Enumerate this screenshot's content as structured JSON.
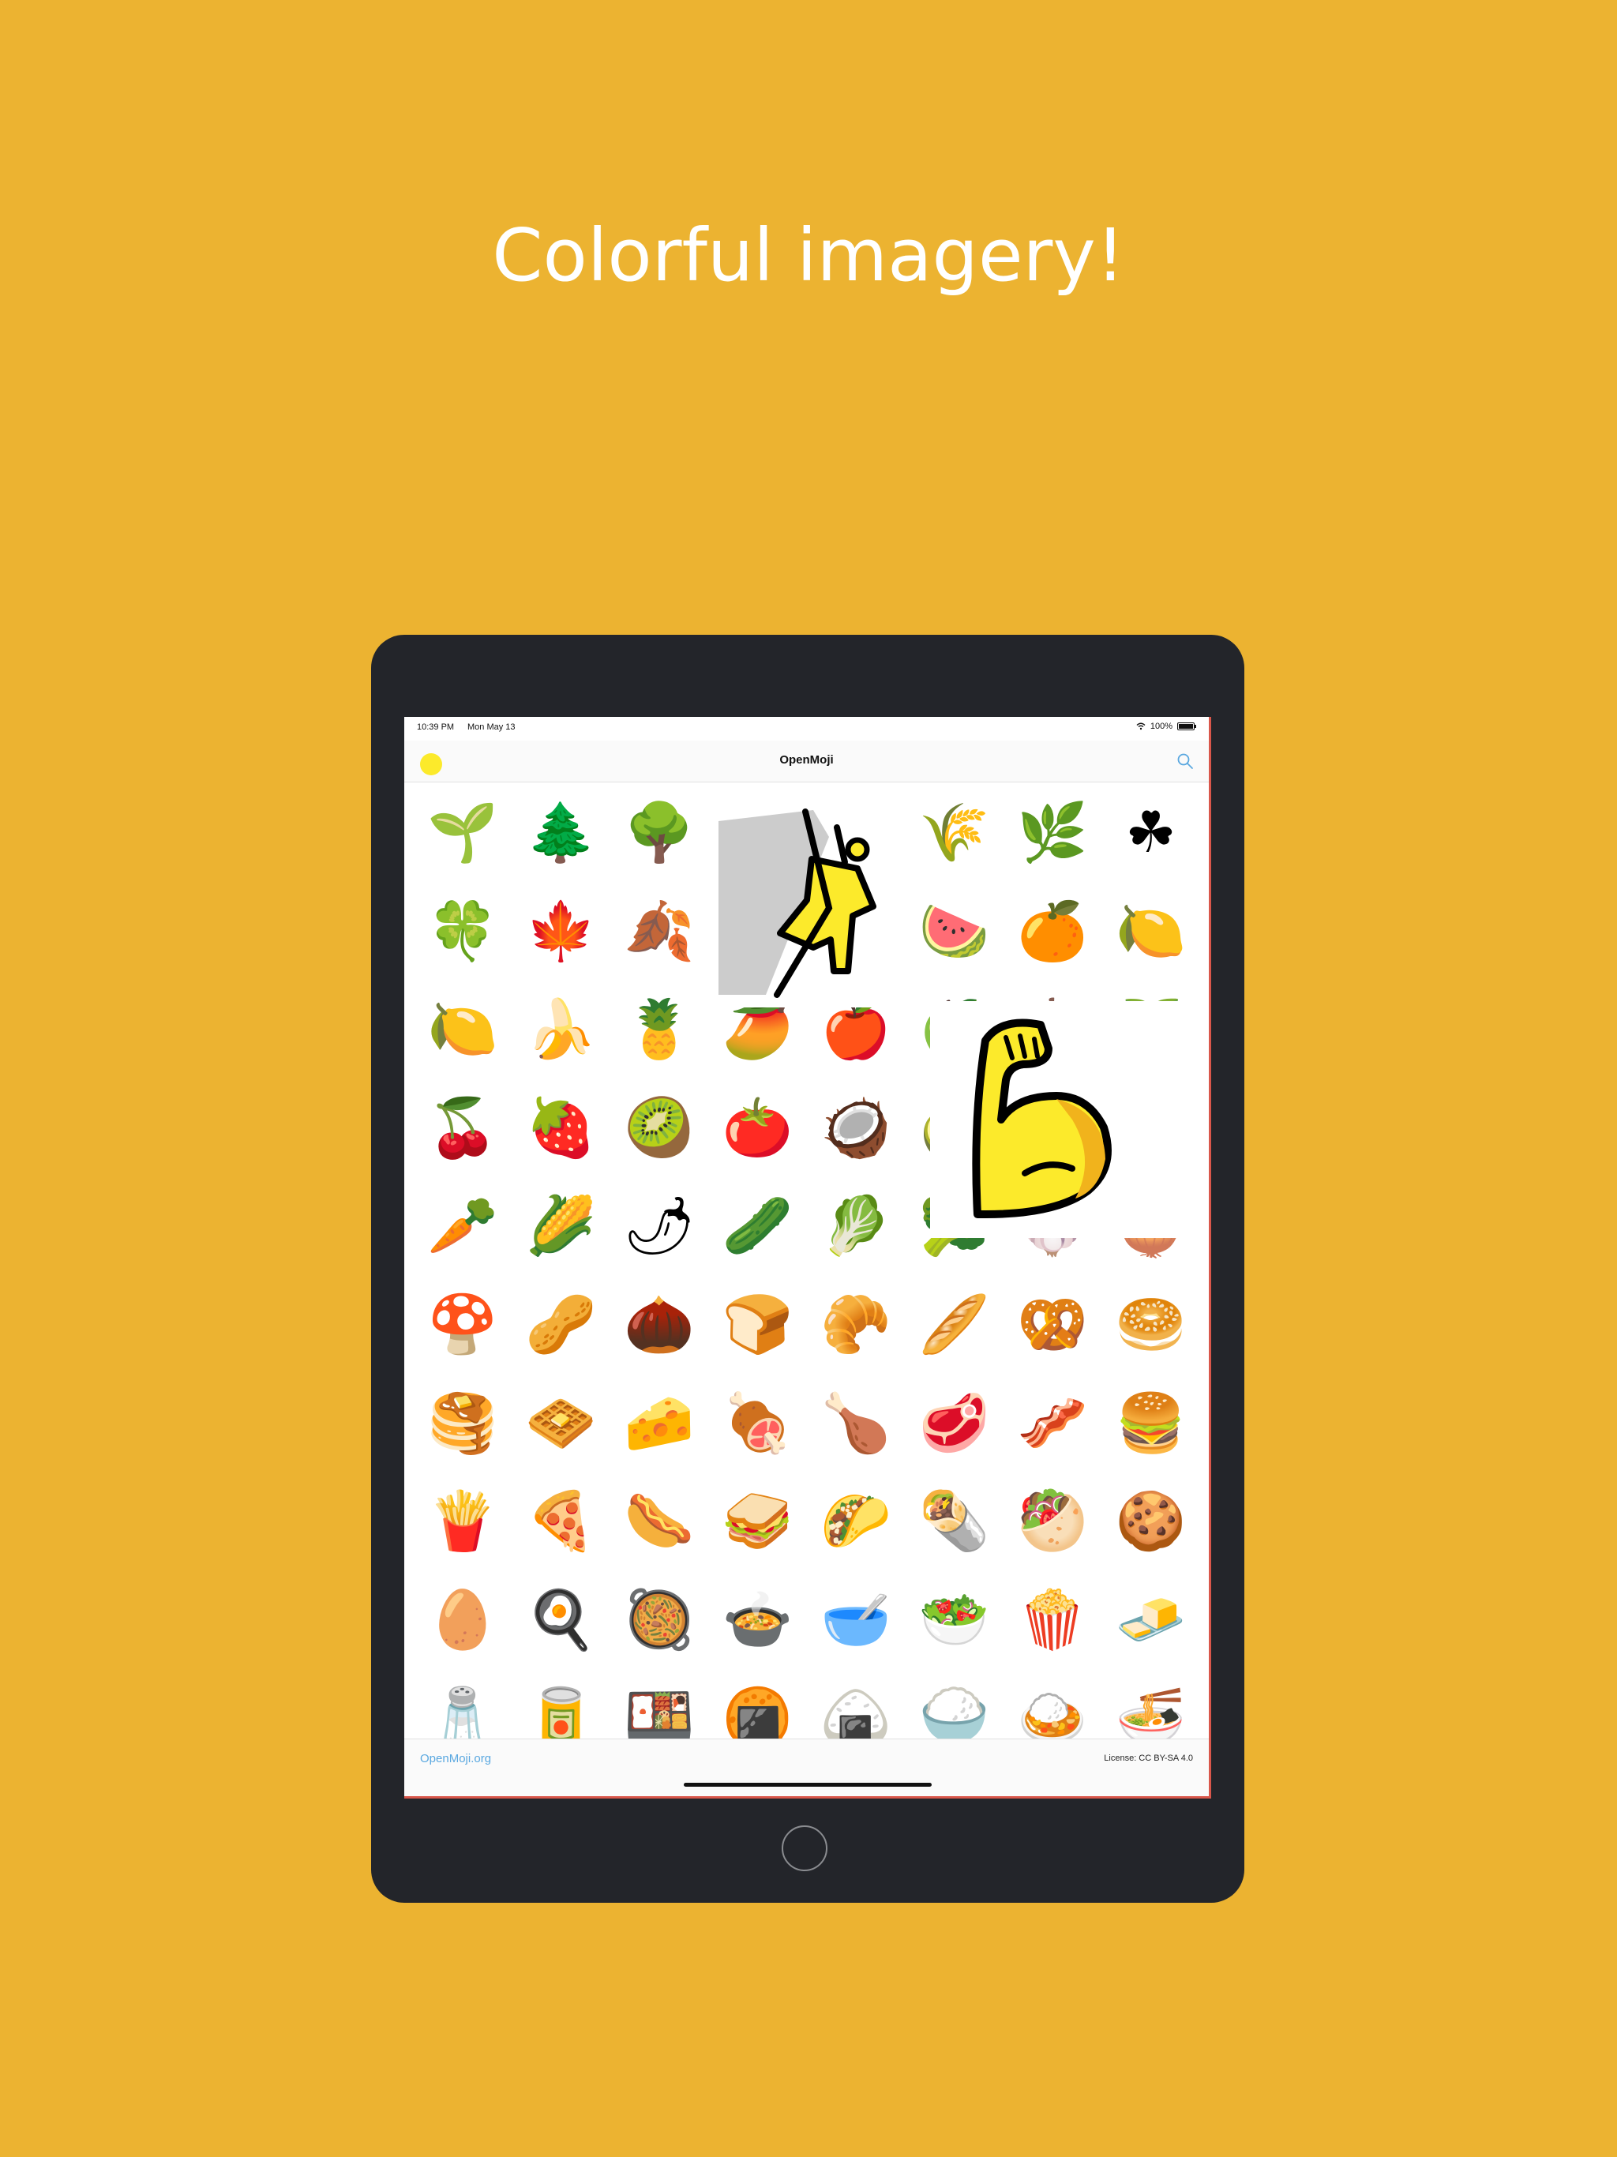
{
  "headline": "Colorful imagery!",
  "status_bar": {
    "time": "10:39 PM",
    "date": "Mon May 13",
    "battery": "100%"
  },
  "nav": {
    "title": "OpenMoji",
    "avatar_color": "#FCEA2B"
  },
  "emoji_grid": [
    [
      "🌱",
      "🌲",
      "🌳",
      "🌴",
      "🌵",
      "🌾",
      "🌿",
      "☘"
    ],
    [
      "🍀",
      "🍁",
      "🍂",
      "🍃",
      "🍈",
      "🍉",
      "🍊",
      "🍋"
    ],
    [
      "🍋",
      "🍌",
      "🍍",
      "🥭",
      "🍎",
      "🍏",
      "🍐",
      "🍑"
    ],
    [
      "🍒",
      "🍓",
      "🥝",
      "🍅",
      "🥥",
      "🥑",
      "🍆",
      "🥔"
    ],
    [
      "🥕",
      "🌽",
      "🌶",
      "🥒",
      "🥬",
      "🥦",
      "🧄",
      "🧅"
    ],
    [
      "🍄",
      "🥜",
      "🌰",
      "🍞",
      "🥐",
      "🥖",
      "🥨",
      "🥯"
    ],
    [
      "🥞",
      "🧇",
      "🧀",
      "🍖",
      "🍗",
      "🥩",
      "🥓",
      "🍔"
    ],
    [
      "🍟",
      "🍕",
      "🌭",
      "🥪",
      "🌮",
      "🌯",
      "🥙",
      "🍪"
    ],
    [
      "🥚",
      "🍳",
      "🥘",
      "🍲",
      "🥣",
      "🥗",
      "🍿",
      "🧈"
    ],
    [
      "🧂",
      "🥫",
      "🍱",
      "🍘",
      "🍙",
      "🍚",
      "🍛",
      "🍜"
    ]
  ],
  "popups": {
    "climber": "🧗",
    "muscle": "💪"
  },
  "footer": {
    "link": "OpenMoji.org",
    "license": "License: CC BY-SA 4.0"
  },
  "colors": {
    "background": "#ECB331",
    "device": "#23252A",
    "link": "#5AA8E0"
  }
}
